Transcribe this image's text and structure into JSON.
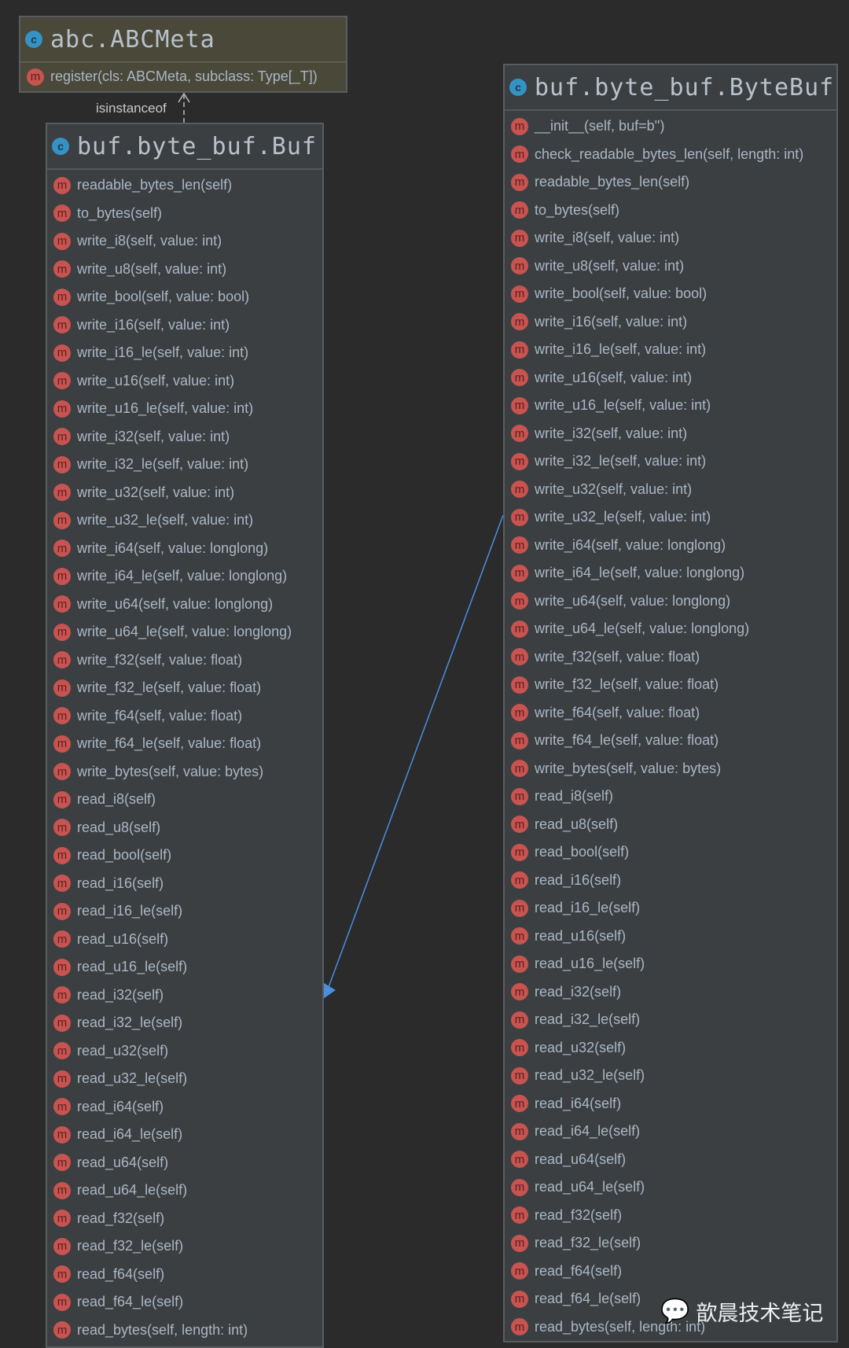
{
  "abc": {
    "title": "abc.ABCMeta",
    "methods": [
      "register(cls: ABCMeta, subclass: Type[_T])"
    ]
  },
  "relation_label": "isinstanceof",
  "buf": {
    "title": "buf.byte_buf.Buf",
    "methods": [
      "readable_bytes_len(self)",
      "to_bytes(self)",
      "write_i8(self, value: int)",
      "write_u8(self, value: int)",
      "write_bool(self, value: bool)",
      "write_i16(self, value: int)",
      "write_i16_le(self, value: int)",
      "write_u16(self, value: int)",
      "write_u16_le(self, value: int)",
      "write_i32(self, value: int)",
      "write_i32_le(self, value: int)",
      "write_u32(self, value: int)",
      "write_u32_le(self, value: int)",
      "write_i64(self, value: longlong)",
      "write_i64_le(self, value: longlong)",
      "write_u64(self, value: longlong)",
      "write_u64_le(self, value: longlong)",
      "write_f32(self, value: float)",
      "write_f32_le(self, value: float)",
      "write_f64(self, value: float)",
      "write_f64_le(self, value: float)",
      "write_bytes(self, value: bytes)",
      "read_i8(self)",
      "read_u8(self)",
      "read_bool(self)",
      "read_i16(self)",
      "read_i16_le(self)",
      "read_u16(self)",
      "read_u16_le(self)",
      "read_i32(self)",
      "read_i32_le(self)",
      "read_u32(self)",
      "read_u32_le(self)",
      "read_i64(self)",
      "read_i64_le(self)",
      "read_u64(self)",
      "read_u64_le(self)",
      "read_f32(self)",
      "read_f32_le(self)",
      "read_f64(self)",
      "read_f64_le(self)",
      "read_bytes(self, length: int)"
    ]
  },
  "bytebuf": {
    "title": "buf.byte_buf.ByteBuf",
    "methods": [
      "__init__(self, buf=b'')",
      "check_readable_bytes_len(self, length: int)",
      "readable_bytes_len(self)",
      "to_bytes(self)",
      "write_i8(self, value: int)",
      "write_u8(self, value: int)",
      "write_bool(self, value: bool)",
      "write_i16(self, value: int)",
      "write_i16_le(self, value: int)",
      "write_u16(self, value: int)",
      "write_u16_le(self, value: int)",
      "write_i32(self, value: int)",
      "write_i32_le(self, value: int)",
      "write_u32(self, value: int)",
      "write_u32_le(self, value: int)",
      "write_i64(self, value: longlong)",
      "write_i64_le(self, value: longlong)",
      "write_u64(self, value: longlong)",
      "write_u64_le(self, value: longlong)",
      "write_f32(self, value: float)",
      "write_f32_le(self, value: float)",
      "write_f64(self, value: float)",
      "write_f64_le(self, value: float)",
      "write_bytes(self, value: bytes)",
      "read_i8(self)",
      "read_u8(self)",
      "read_bool(self)",
      "read_i16(self)",
      "read_i16_le(self)",
      "read_u16(self)",
      "read_u16_le(self)",
      "read_i32(self)",
      "read_i32_le(self)",
      "read_u32(self)",
      "read_u32_le(self)",
      "read_i64(self)",
      "read_i64_le(self)",
      "read_u64(self)",
      "read_u64_le(self)",
      "read_f32(self)",
      "read_f32_le(self)",
      "read_f64(self)",
      "read_f64_le(self)",
      "read_bytes(self, length: int)"
    ]
  },
  "watermark": "歆晨技术笔记",
  "icons": {
    "class": "c",
    "method": "m"
  }
}
